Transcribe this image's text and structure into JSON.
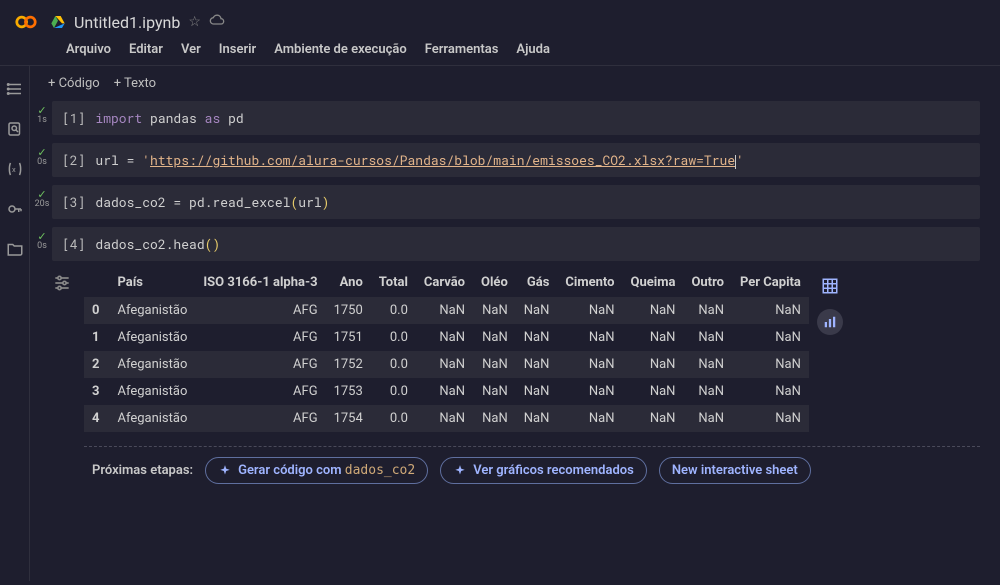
{
  "header": {
    "title": "Untitled1.ipynb"
  },
  "menubar": {
    "arquivo": "Arquivo",
    "editar": "Editar",
    "ver": "Ver",
    "inserir": "Inserir",
    "ambiente": "Ambiente de execução",
    "ferramentas": "Ferramentas",
    "ajuda": "Ajuda"
  },
  "toolbar": {
    "code": "+ Código",
    "text": "+ Texto"
  },
  "cells": {
    "c1": {
      "runtime": "1s",
      "prompt": "[1]",
      "line1_import": "import",
      "line1_pandas": "pandas",
      "line1_as": "as",
      "line1_pd": "pd"
    },
    "c2": {
      "runtime": "0s",
      "prompt": "[2]",
      "var": "url",
      "eq": " = ",
      "str_q": "'",
      "str_url": "https://github.com/alura-cursos/Pandas/blob/main/emissoes_CO2.xlsx?raw=True",
      "str_q2": "'"
    },
    "c3": {
      "runtime": "20s",
      "prompt": "[3]",
      "var": "dados_co2",
      "eq": " = ",
      "call": "pd.read_excel",
      "arg": "url"
    },
    "c4": {
      "runtime": "0s",
      "prompt": "[4]",
      "call": "dados_co2.head"
    }
  },
  "table": {
    "headers": {
      "pais": "País",
      "iso": "ISO 3166-1 alpha-3",
      "ano": "Ano",
      "total": "Total",
      "carvao": "Carvão",
      "oleo": "Oléo",
      "gas": "Gás",
      "cimento": "Cimento",
      "queima": "Queima",
      "outro": "Outro",
      "percapita": "Per Capita"
    },
    "rows": [
      {
        "idx": "0",
        "pais": "Afeganistão",
        "iso": "AFG",
        "ano": "1750",
        "total": "0.0",
        "carvao": "NaN",
        "oleo": "NaN",
        "gas": "NaN",
        "cimento": "NaN",
        "queima": "NaN",
        "outro": "NaN",
        "percapita": "NaN"
      },
      {
        "idx": "1",
        "pais": "Afeganistão",
        "iso": "AFG",
        "ano": "1751",
        "total": "0.0",
        "carvao": "NaN",
        "oleo": "NaN",
        "gas": "NaN",
        "cimento": "NaN",
        "queima": "NaN",
        "outro": "NaN",
        "percapita": "NaN"
      },
      {
        "idx": "2",
        "pais": "Afeganistão",
        "iso": "AFG",
        "ano": "1752",
        "total": "0.0",
        "carvao": "NaN",
        "oleo": "NaN",
        "gas": "NaN",
        "cimento": "NaN",
        "queima": "NaN",
        "outro": "NaN",
        "percapita": "NaN"
      },
      {
        "idx": "3",
        "pais": "Afeganistão",
        "iso": "AFG",
        "ano": "1753",
        "total": "0.0",
        "carvao": "NaN",
        "oleo": "NaN",
        "gas": "NaN",
        "cimento": "NaN",
        "queima": "NaN",
        "outro": "NaN",
        "percapita": "NaN"
      },
      {
        "idx": "4",
        "pais": "Afeganistão",
        "iso": "AFG",
        "ano": "1754",
        "total": "0.0",
        "carvao": "NaN",
        "oleo": "NaN",
        "gas": "NaN",
        "cimento": "NaN",
        "queima": "NaN",
        "outro": "NaN",
        "percapita": "NaN"
      }
    ]
  },
  "next_steps": {
    "label": "Próximas etapas:",
    "chip1_prefix": "Gerar código com ",
    "chip1_var": "dados_co2",
    "chip2": "Ver gráficos recomendados",
    "chip3": "New interactive sheet"
  }
}
